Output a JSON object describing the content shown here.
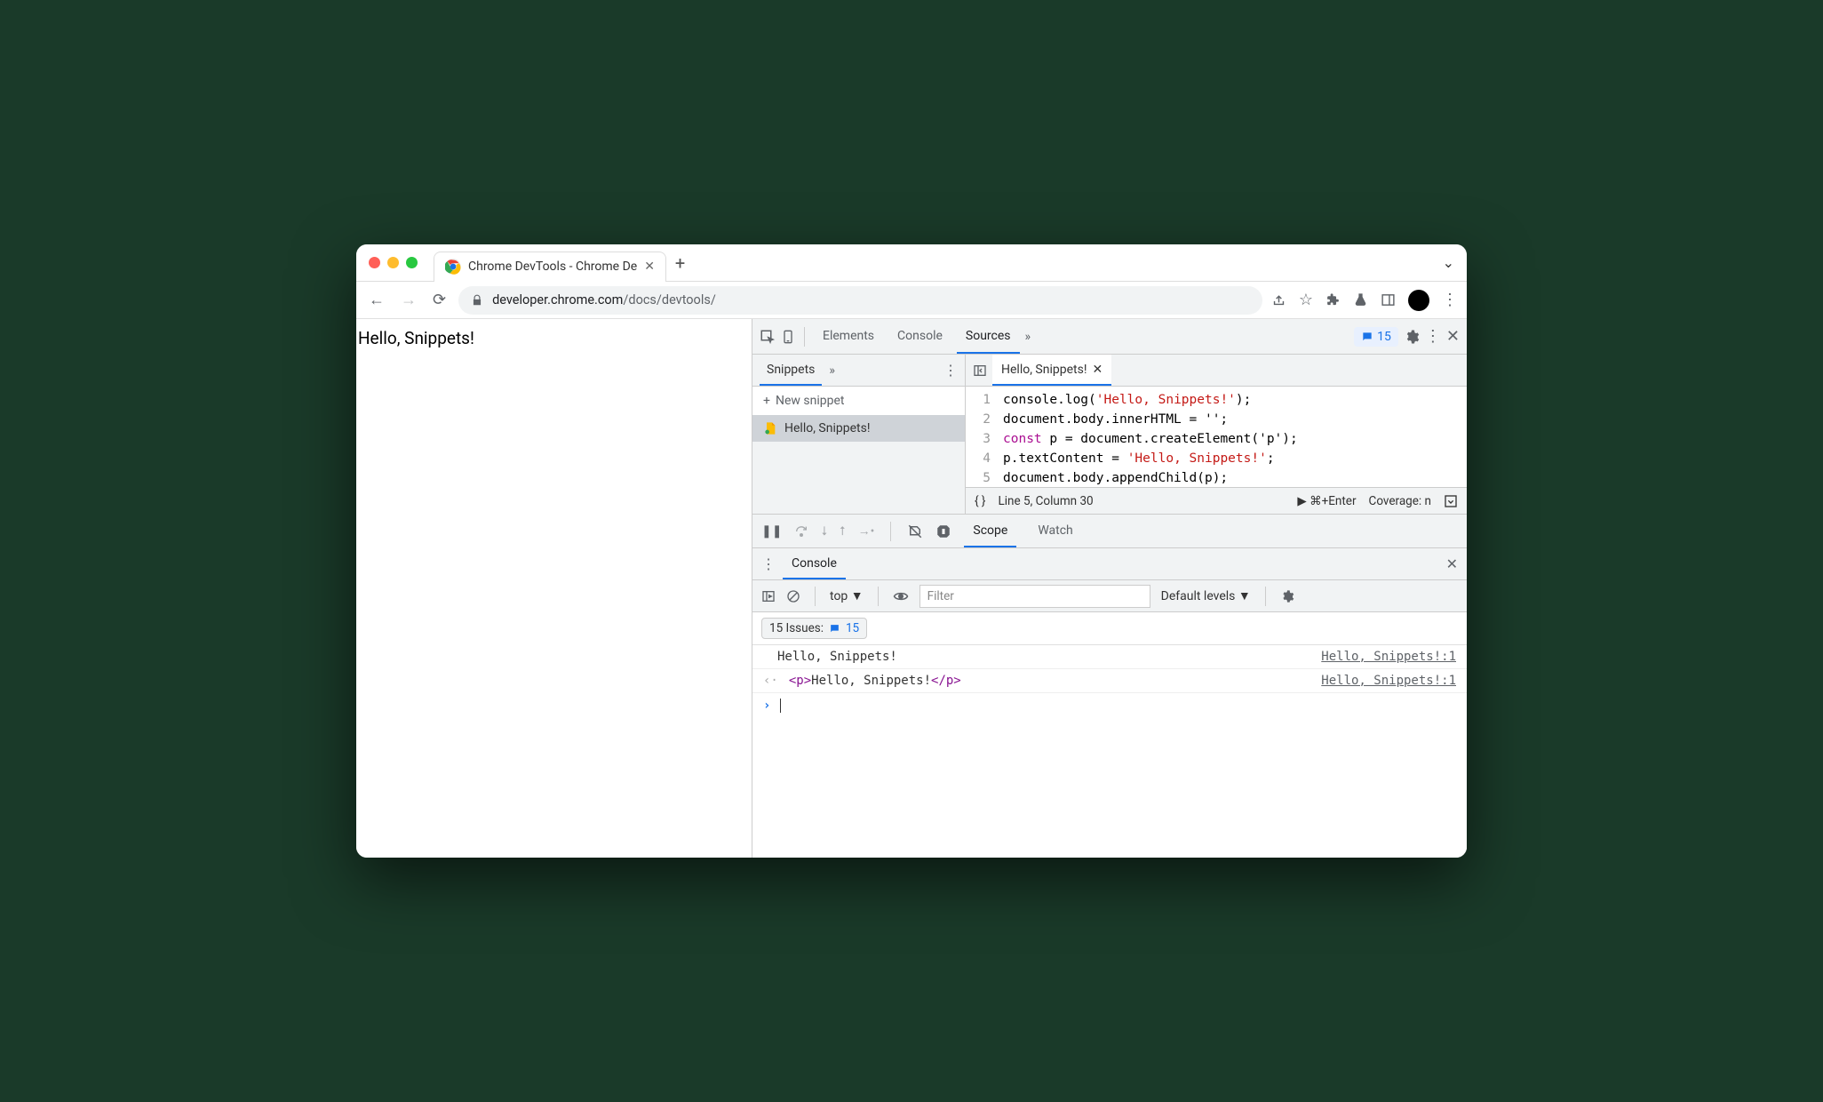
{
  "browser": {
    "tab_title": "Chrome DevTools - Chrome De",
    "url_domain": "developer.chrome.com",
    "url_path": "/docs/devtools/"
  },
  "page": {
    "body_text": "Hello, Snippets!"
  },
  "devtools": {
    "tabs": {
      "elements": "Elements",
      "console": "Console",
      "sources": "Sources"
    },
    "issues_count": "15",
    "snippets": {
      "tab_label": "Snippets",
      "new_label": "New snippet",
      "item_name": "Hello, Snippets!"
    },
    "editor": {
      "tab_name": "Hello, Snippets!",
      "code": {
        "l1_a": "console.log(",
        "l1_str": "'Hello, Snippets!'",
        "l1_b": ");",
        "l2": "document.body.innerHTML = '';",
        "l3_kw": "const",
        "l3_rest": " p = document.createElement('p');",
        "l4_a": "p.textContent = ",
        "l4_str": "'Hello, Snippets!'",
        "l4_b": ";",
        "l5": "document.body.appendChild(p);"
      },
      "line_numbers": [
        "1",
        "2",
        "3",
        "4",
        "5"
      ],
      "status": {
        "cursor": "Line 5, Column 30",
        "run": "⌘+Enter",
        "coverage": "Coverage: n"
      }
    },
    "debugger": {
      "scope": "Scope",
      "watch": "Watch"
    },
    "console_drawer": {
      "label": "Console",
      "context": "top",
      "filter_placeholder": "Filter",
      "levels": "Default levels",
      "issues_label": "15 Issues:",
      "issues_link_count": "15",
      "messages": [
        {
          "text": "Hello, Snippets!",
          "source": "Hello, Snippets!:1"
        },
        {
          "html_open": "<p>",
          "html_text": "Hello, Snippets!",
          "html_close": "</p>",
          "source": "Hello, Snippets!:1"
        }
      ]
    }
  }
}
